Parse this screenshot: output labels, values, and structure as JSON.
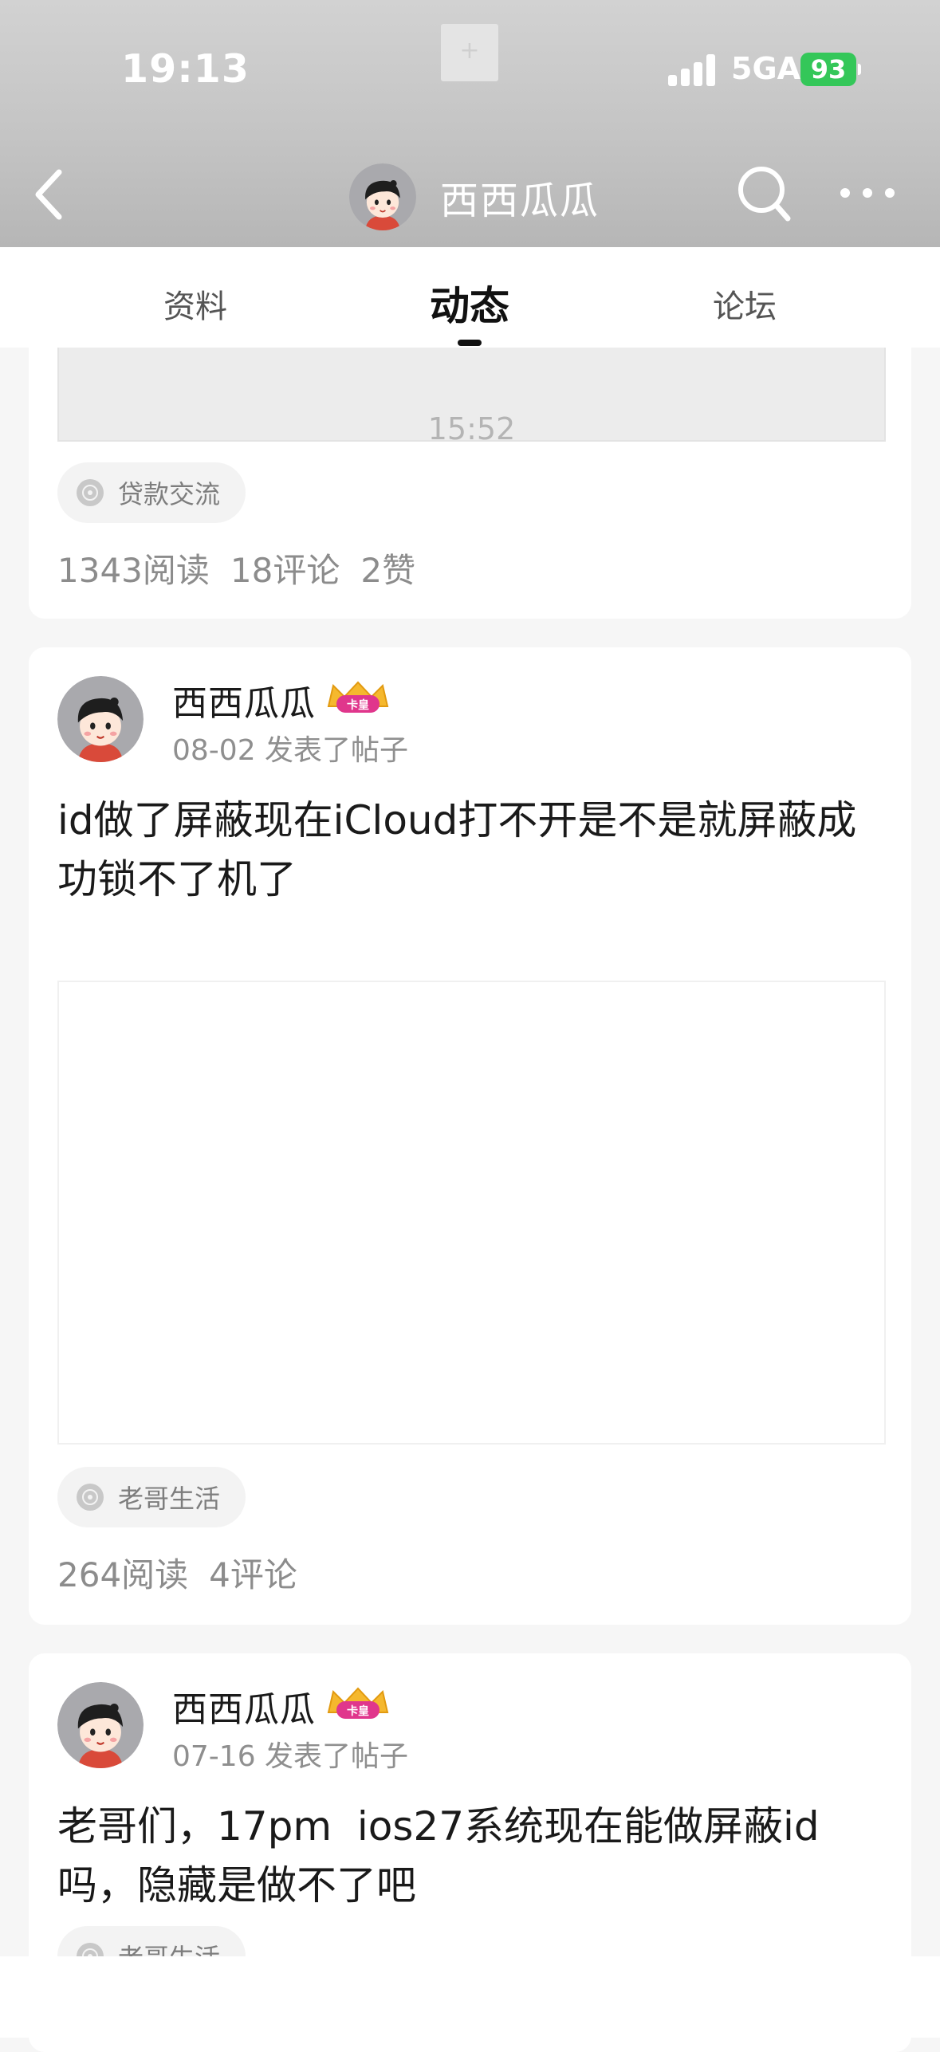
{
  "status_bar": {
    "time": "19:13",
    "network": "5GA",
    "battery": "93"
  },
  "header": {
    "title": "西西瓜瓜",
    "icons": [
      "chevron-left-icon",
      "search-icon",
      "more-dots-icon"
    ]
  },
  "tabs": [
    {
      "label": "资料",
      "active": false
    },
    {
      "label": "动态",
      "active": true
    },
    {
      "label": "论坛",
      "active": false
    }
  ],
  "posts": [
    {
      "image_caption": "15:52",
      "forum": "贷款交流",
      "stats": {
        "reads": "1343阅读",
        "comments": "18评论",
        "likes": "2赞"
      }
    },
    {
      "author": "西西瓜瓜",
      "badge": "卡皇",
      "meta": "08-02 发表了帖子",
      "text": "id做了屏蔽现在iCloud打不开是不是就屏蔽成功锁不了机了",
      "forum": "老哥生活",
      "stats": {
        "reads": "264阅读",
        "comments": "4评论"
      }
    },
    {
      "author": "西西瓜瓜",
      "badge": "卡皇",
      "meta": "07-16 发表了帖子",
      "text": "老哥们，17pm  ios27系统现在能做屏蔽id吗，隐藏是做不了吧",
      "forum": "老哥生活"
    }
  ],
  "colors": {
    "battery": "#34c759",
    "badge": "#e0368c",
    "crown": "#f5b82e"
  }
}
